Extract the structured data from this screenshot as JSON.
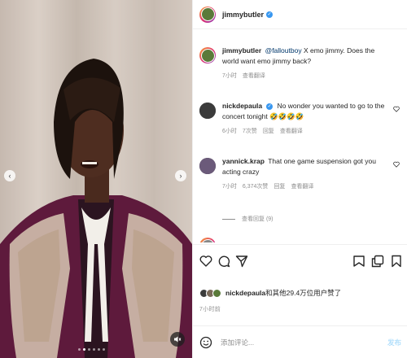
{
  "header": {
    "username": "jimmybutler",
    "verified": true
  },
  "caption": {
    "author": "jimmybutler",
    "mention": "@falloutboy",
    "text": " X emo jimmy. Does the world want emo jimmy back?",
    "time": "7小时",
    "translate": "查看翻译"
  },
  "comments": [
    {
      "author": "nickdepaula",
      "verified": true,
      "text": "No wonder you wanted to go to the concert tonight 🤣🤣🤣🤣",
      "time": "6小时",
      "likes": "7次赞",
      "reply": "回复",
      "translate": "查看翻译"
    },
    {
      "author": "yannick.krap",
      "verified": false,
      "text": "That one game suspension got you acting crazy",
      "time": "7小时",
      "likes": "6,374次赞",
      "reply": "回复",
      "translate": "查看翻译"
    }
  ],
  "view_replies": "查看回复 (9)",
  "likes": {
    "name": "nickdepaula",
    "text": "和其他29.4万位用户赞了"
  },
  "post_time": "7小时前",
  "comment_box": {
    "placeholder": "添加评论...",
    "post_label": "发布"
  },
  "icons": {
    "like": "heart-icon",
    "comment": "comment-icon",
    "share": "share-icon",
    "save": "bookmark-icon",
    "emoji": "emoji-icon",
    "mute": "speaker-icon",
    "prev": "chevron-left-icon",
    "next": "chevron-right-icon"
  },
  "colors": {
    "verified": "#3897f0",
    "post_disabled": "#b2dffc",
    "secondary_text": "#8e8e8e"
  }
}
